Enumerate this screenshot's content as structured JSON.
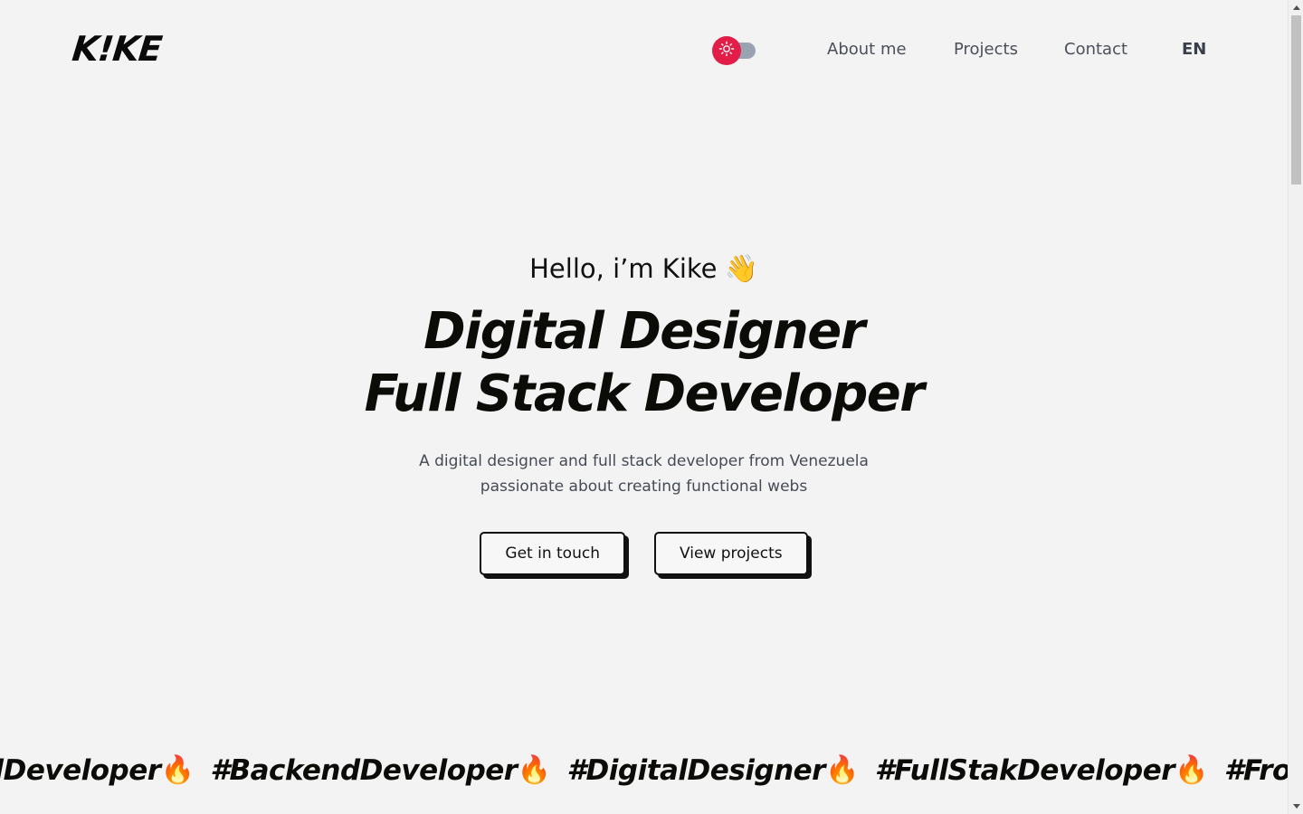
{
  "header": {
    "logo_text": "K!KE",
    "theme_toggle": {
      "icon": "sun-icon",
      "state": "light"
    },
    "nav": {
      "about": "About me",
      "projects": "Projects",
      "contact": "Contact",
      "language": "EN"
    }
  },
  "hero": {
    "greeting": "Hello, i’m Kike",
    "greeting_emoji": "👋",
    "headline_line1": "Digital Designer",
    "headline_line2": "Full Stack Developer",
    "subtitle_line1": "A digital designer and full stack developer from Venezuela",
    "subtitle_line2": "passionate about creating functional webs",
    "cta_primary": "Get in touch",
    "cta_secondary": "View projects"
  },
  "marquee": {
    "emoji": "🔥",
    "tags": [
      "#FrontendDeveloper",
      "#BackendDeveloper",
      "#DigitalDesigner",
      "#FullStakDeveloper",
      "#Frontend"
    ]
  },
  "colors": {
    "background": "#f3f3f3",
    "accent": "#e11d48",
    "text": "#0b0b08",
    "muted": "#4a4f5a"
  }
}
